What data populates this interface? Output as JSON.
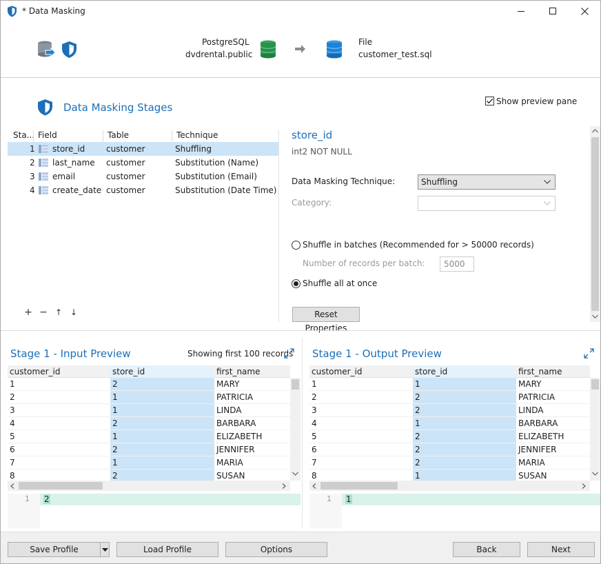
{
  "window": {
    "title": "* Data Masking"
  },
  "header": {
    "source_db": "PostgreSQL",
    "source_schema": "dvdrental.public",
    "target_type": "File",
    "target_file": "customer_test.sql"
  },
  "stages": {
    "title": "Data Masking Stages",
    "show_preview_label": "Show preview pane",
    "show_preview_checked": true,
    "columns": [
      "Sta...",
      "Field",
      "Table",
      "Technique"
    ],
    "rows": [
      {
        "num": "1",
        "field": "store_id",
        "table": "customer",
        "technique": "Shuffling",
        "selected": true
      },
      {
        "num": "2",
        "field": "last_name",
        "table": "customer",
        "technique": "Substitution (Name)",
        "selected": false
      },
      {
        "num": "3",
        "field": "email",
        "table": "customer",
        "technique": "Substitution (Email)",
        "selected": false
      },
      {
        "num": "4",
        "field": "create_date",
        "table": "customer",
        "technique": "Substitution (Date Time)",
        "selected": false
      }
    ],
    "toolbar": {
      "add": "+",
      "remove": "−",
      "up": "↑",
      "down": "↓"
    }
  },
  "properties": {
    "field_name": "store_id",
    "field_type": "int2 NOT NULL",
    "technique_label": "Data Masking Technique:",
    "technique_value": "Shuffling",
    "category_label": "Category:",
    "category_value": "",
    "batches_label": "Shuffle in batches (Recommended for > 50000 records)",
    "batches_selected": false,
    "records_label": "Number of records per batch:",
    "records_value": "5000",
    "all_label": "Shuffle all at once",
    "all_selected": true,
    "reset_label": "Reset Properties"
  },
  "input_preview": {
    "title": "Stage 1 - Input Preview",
    "note": "Showing first 100 records",
    "columns": [
      "customer_id",
      "store_id",
      "first_name"
    ],
    "rows": [
      [
        "1",
        "2",
        "MARY"
      ],
      [
        "2",
        "1",
        "PATRICIA"
      ],
      [
        "3",
        "1",
        "LINDA"
      ],
      [
        "4",
        "2",
        "BARBARA"
      ],
      [
        "5",
        "1",
        "ELIZABETH"
      ],
      [
        "6",
        "2",
        "JENNIFER"
      ],
      [
        "7",
        "1",
        "MARIA"
      ],
      [
        "8",
        "2",
        "SUSAN"
      ]
    ],
    "line_number": "1",
    "value": "2"
  },
  "output_preview": {
    "title": "Stage 1 - Output Preview",
    "columns": [
      "customer_id",
      "store_id",
      "first_name"
    ],
    "rows": [
      [
        "1",
        "1",
        "MARY"
      ],
      [
        "2",
        "2",
        "PATRICIA"
      ],
      [
        "3",
        "2",
        "LINDA"
      ],
      [
        "4",
        "1",
        "BARBARA"
      ],
      [
        "5",
        "2",
        "ELIZABETH"
      ],
      [
        "6",
        "2",
        "JENNIFER"
      ],
      [
        "7",
        "2",
        "MARIA"
      ],
      [
        "8",
        "1",
        "SUSAN"
      ]
    ],
    "line_number": "1",
    "value": "1"
  },
  "footer": {
    "save_profile": "Save Profile",
    "load_profile": "Load Profile",
    "options": "Options",
    "back": "Back",
    "next": "Next"
  }
}
